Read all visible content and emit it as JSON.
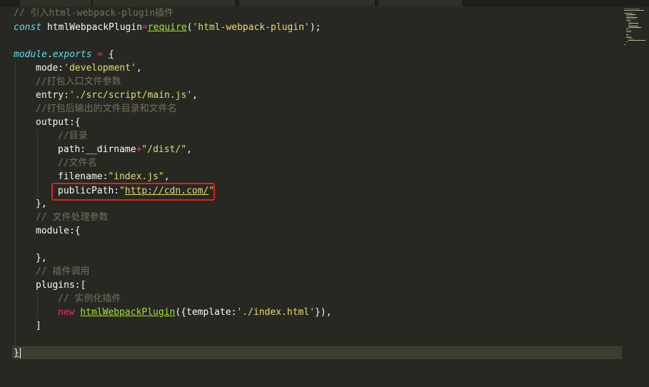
{
  "colors": {
    "background": "#272822",
    "comment": "#75715e",
    "keyword": "#f92672",
    "storage": "#66d9ef",
    "string": "#e6db74",
    "function": "#a6e22e",
    "text": "#f8f8f2",
    "highlight_box": "#e0211f",
    "current_line": "#3e3d32"
  },
  "code": {
    "l1": "// 引入html-webpack-plugin插件",
    "l2_const": "const",
    "l2_name": " htmlWebpackPlugin",
    "l2_eq": "=",
    "l2_req": "require",
    "l2_open": "(",
    "l2_str": "'html-webpack-plugin'",
    "l2_close": ");",
    "l4_module": "module",
    "l4_dot": ".",
    "l4_exports": "exports",
    "l4_eq": " = ",
    "l4_brace": "{",
    "l5_key": "mode:",
    "l5_val": "'development'",
    "l5_comma": ",",
    "l6": "//打包入口文件参数",
    "l7_key": "entry:",
    "l7_val": "'./src/script/main.js'",
    "l7_comma": ",",
    "l8": "//打包后输出的文件目录和文件名",
    "l9": "output:{",
    "l10": "//目录",
    "l11_key": "path:",
    "l11_var": "__dirname",
    "l11_plus": "+",
    "l11_str": "\"/dist/\"",
    "l11_comma": ",",
    "l12": "//文件名",
    "l13_key": "filename:",
    "l13_val": "\"index.js\"",
    "l13_comma": ",",
    "l14_key": "publicPath:",
    "l14_q1": "\"",
    "l14_url": "http://cdn.com/",
    "l14_q2": "\"",
    "l15": "},",
    "l16": "// 文件处理参数",
    "l17": "module:{",
    "l19": "},",
    "l20": "// 插件调用",
    "l21": "plugins:[",
    "l22": "// 实例化插件",
    "l23_new": "new",
    "l23_fn": "htmlWebpackPlugin",
    "l23_open": "({template:",
    "l23_str": "'./index.html'",
    "l23_close": "}),",
    "l24": "]",
    "l26": "}"
  }
}
